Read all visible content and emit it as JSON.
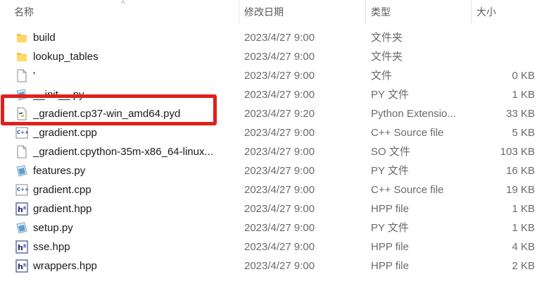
{
  "header": {
    "col_name": "名称",
    "col_date": "修改日期",
    "col_type": "类型",
    "col_size": "大小",
    "sort_indicator": "^"
  },
  "rows": [
    {
      "name": "build",
      "date": "2023/4/27 9:00",
      "type": "文件夹",
      "size": "",
      "icon": "folder-icon"
    },
    {
      "name": "lookup_tables",
      "date": "2023/4/27 9:00",
      "type": "文件夹",
      "size": "",
      "icon": "folder-icon"
    },
    {
      "name": "'",
      "date": "2023/4/27 9:00",
      "type": "文件",
      "size": "0 KB",
      "icon": "blank-file-icon"
    },
    {
      "name": "__init__.py",
      "date": "2023/4/27 9:00",
      "type": "PY 文件",
      "size": "1 KB",
      "icon": "py-file-icon"
    },
    {
      "name": "_gradient.cp37-win_amd64.pyd",
      "date": "2023/4/27 9:20",
      "type": "Python Extensio...",
      "size": "33 KB",
      "icon": "python-extension-icon"
    },
    {
      "name": "_gradient.cpp",
      "date": "2023/4/27 9:00",
      "type": "C++ Source file",
      "size": "5 KB",
      "icon": "cpp-file-icon"
    },
    {
      "name": "_gradient.cpython-35m-x86_64-linux...",
      "date": "2023/4/27 9:00",
      "type": "SO 文件",
      "size": "103 KB",
      "icon": "blank-file-icon"
    },
    {
      "name": "features.py",
      "date": "2023/4/27 9:00",
      "type": "PY 文件",
      "size": "16 KB",
      "icon": "py-file-icon"
    },
    {
      "name": "gradient.cpp",
      "date": "2023/4/27 9:00",
      "type": "C++ Source file",
      "size": "19 KB",
      "icon": "cpp-file-icon"
    },
    {
      "name": "gradient.hpp",
      "date": "2023/4/27 9:00",
      "type": "HPP file",
      "size": "1 KB",
      "icon": "hpp-file-icon"
    },
    {
      "name": "setup.py",
      "date": "2023/4/27 9:00",
      "type": "PY 文件",
      "size": "1 KB",
      "icon": "py-file-icon"
    },
    {
      "name": "sse.hpp",
      "date": "2023/4/27 9:00",
      "type": "HPP file",
      "size": "4 KB",
      "icon": "hpp-file-icon"
    },
    {
      "name": "wrappers.hpp",
      "date": "2023/4/27 9:00",
      "type": "HPP file",
      "size": "2 KB",
      "icon": "hpp-file-icon"
    }
  ],
  "colors": {
    "highlight": "#e0201b",
    "folder": "#f5c242",
    "text_secondary": "#6b6b6b"
  }
}
